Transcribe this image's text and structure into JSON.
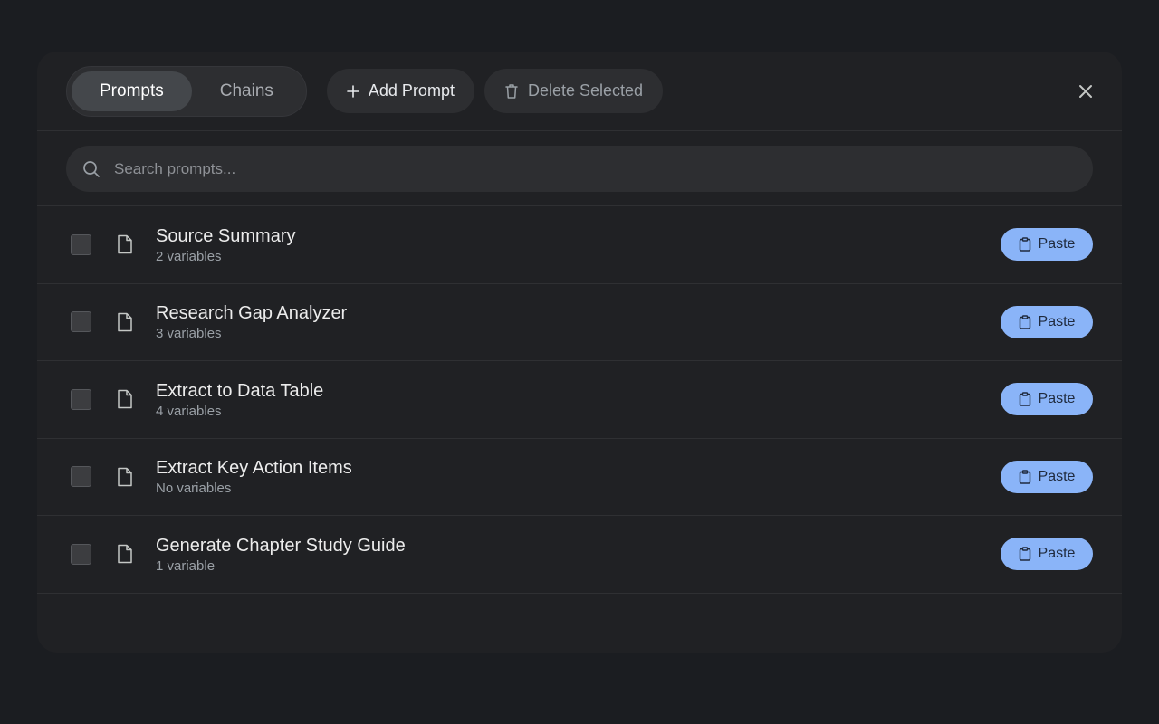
{
  "tabs": [
    {
      "label": "Prompts",
      "active": true
    },
    {
      "label": "Chains",
      "active": false
    }
  ],
  "toolbar": {
    "add_label": "Add Prompt",
    "delete_label": "Delete Selected"
  },
  "search": {
    "placeholder": "Search prompts..."
  },
  "prompts": [
    {
      "title": "Source Summary",
      "subtitle": "2 variables",
      "action": "Paste"
    },
    {
      "title": "Research Gap Analyzer",
      "subtitle": "3 variables",
      "action": "Paste"
    },
    {
      "title": "Extract to Data Table",
      "subtitle": "4 variables",
      "action": "Paste"
    },
    {
      "title": "Extract Key Action Items",
      "subtitle": "No variables",
      "action": "Paste"
    },
    {
      "title": "Generate Chapter Study Guide",
      "subtitle": "1 variable",
      "action": "Paste"
    }
  ],
  "colors": {
    "accent": "#8ab4f8",
    "panel": "#202124",
    "background": "#1b1d21"
  }
}
